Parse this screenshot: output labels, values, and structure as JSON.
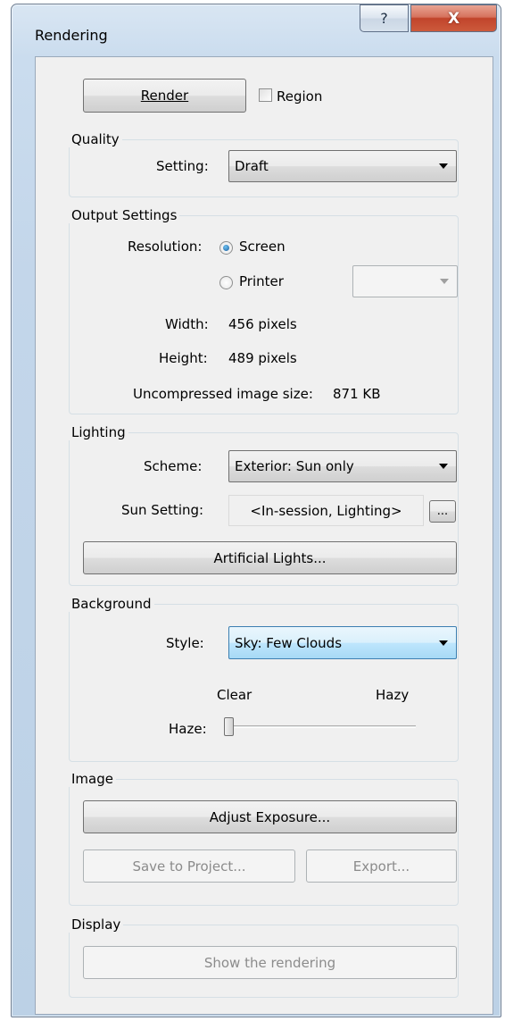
{
  "window": {
    "title": "Rendering",
    "help_glyph": "?",
    "close_glyph": "X"
  },
  "render": {
    "button_label": "Render",
    "region_label": "Region",
    "region_checked": false
  },
  "quality": {
    "group_title": "Quality",
    "setting_label": "Setting:",
    "setting_value": "Draft"
  },
  "output": {
    "group_title": "Output Settings",
    "resolution_label": "Resolution:",
    "screen_label": "Screen",
    "printer_label": "Printer",
    "selected": "Screen",
    "printer_value": "",
    "width_label": "Width:",
    "width_value": "456 pixels",
    "height_label": "Height:",
    "height_value": "489 pixels",
    "size_label": "Uncompressed image size:",
    "size_value": "871 KB"
  },
  "lighting": {
    "group_title": "Lighting",
    "scheme_label": "Scheme:",
    "scheme_value": "Exterior: Sun only",
    "sun_label": "Sun Setting:",
    "sun_value": "<In-session, Lighting>",
    "sun_browse": "...",
    "artificial_button": "Artificial Lights..."
  },
  "background": {
    "group_title": "Background",
    "style_label": "Style:",
    "style_value": "Sky: Few Clouds",
    "clear_label": "Clear",
    "hazy_label": "Hazy",
    "haze_label": "Haze:",
    "haze_level": 0
  },
  "image": {
    "group_title": "Image",
    "adjust_button": "Adjust Exposure...",
    "save_button": "Save to Project...",
    "export_button": "Export..."
  },
  "display": {
    "group_title": "Display",
    "show_button": "Show the rendering"
  },
  "colors": {
    "frame": "#c3d6ea",
    "client": "#f0f0f0",
    "close": "#c1442b",
    "active_combo": "#bee6fd"
  }
}
